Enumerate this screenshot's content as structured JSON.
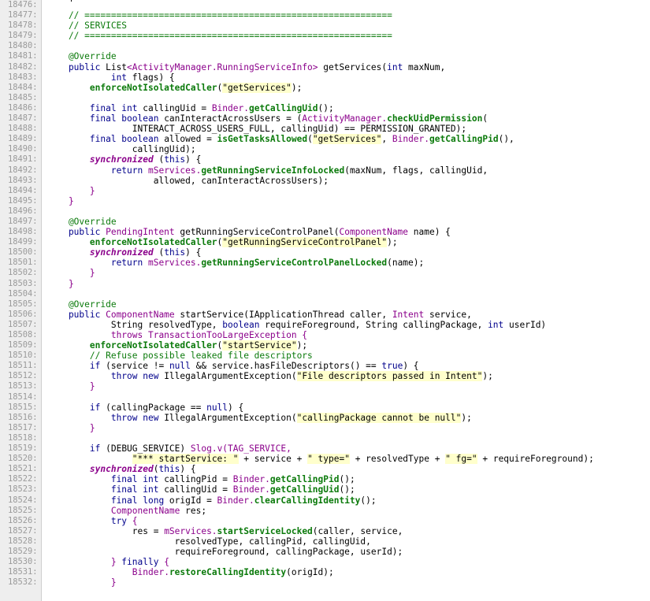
{
  "colors": {
    "comment": "#0b7a0b",
    "keyword": "#00008b",
    "type": "#8b008b",
    "method": "#0b7a0b",
    "string": "#000000",
    "string_bg": "#ffffcc",
    "annotation": "#0b7a0b",
    "line_number": "#9a9a9a",
    "gutter_bg": "#eeeeee"
  },
  "lines": [
    {
      "n": "18476:",
      "seg": [
        [
          "",
          ""
        ]
      ]
    },
    {
      "n": "18477:",
      "seg": [
        [
          "    // ==========================================================",
          "c"
        ]
      ]
    },
    {
      "n": "18478:",
      "seg": [
        [
          "    // SERVICES",
          "c"
        ]
      ]
    },
    {
      "n": "18479:",
      "seg": [
        [
          "    // ==========================================================",
          "c"
        ]
      ]
    },
    {
      "n": "18480:",
      "seg": [
        [
          "",
          ""
        ]
      ]
    },
    {
      "n": "18481:",
      "seg": [
        [
          "    @Override",
          "a"
        ]
      ]
    },
    {
      "n": "18482:",
      "seg": [
        [
          "    public ",
          "k"
        ],
        [
          "List",
          "p"
        ],
        [
          "<ActivityManager.RunningServiceInfo>",
          "t"
        ],
        [
          " getServices(",
          "p"
        ],
        [
          "int",
          "k"
        ],
        [
          " maxNum,",
          "p"
        ]
      ]
    },
    {
      "n": "18483:",
      "seg": [
        [
          "            ",
          "p"
        ],
        [
          "int",
          "k"
        ],
        [
          " flags) {",
          "p"
        ]
      ]
    },
    {
      "n": "18484:",
      "seg": [
        [
          "        ",
          "p"
        ],
        [
          "enforceNotIsolatedCaller",
          "m"
        ],
        [
          "(",
          "p"
        ],
        [
          "\"getServices\"",
          "s"
        ],
        [
          ");",
          "p"
        ]
      ]
    },
    {
      "n": "18485:",
      "seg": [
        [
          "",
          ""
        ]
      ]
    },
    {
      "n": "18486:",
      "seg": [
        [
          "        ",
          "p"
        ],
        [
          "final int",
          "k"
        ],
        [
          " callingUid = ",
          "p"
        ],
        [
          "Binder.",
          "t"
        ],
        [
          "getCallingUid",
          "m"
        ],
        [
          "();",
          "p"
        ]
      ]
    },
    {
      "n": "18487:",
      "seg": [
        [
          "        ",
          "p"
        ],
        [
          "final boolean",
          "k"
        ],
        [
          " canInteractAcrossUsers = (",
          "p"
        ],
        [
          "ActivityManager.",
          "t"
        ],
        [
          "checkUidPermission",
          "m"
        ],
        [
          "(",
          "p"
        ]
      ]
    },
    {
      "n": "18488:",
      "seg": [
        [
          "                INTERACT_ACROSS_USERS_FULL, callingUid) == PERMISSION_GRANTED);",
          "p"
        ]
      ]
    },
    {
      "n": "18489:",
      "seg": [
        [
          "        ",
          "p"
        ],
        [
          "final boolean",
          "k"
        ],
        [
          " allowed = ",
          "p"
        ],
        [
          "isGetTasksAllowed",
          "m"
        ],
        [
          "(",
          "p"
        ],
        [
          "\"getServices\"",
          "s"
        ],
        [
          ", ",
          "p"
        ],
        [
          "Binder.",
          "t"
        ],
        [
          "getCallingPid",
          "m"
        ],
        [
          "(),",
          "p"
        ]
      ]
    },
    {
      "n": "18490:",
      "seg": [
        [
          "                callingUid);",
          "p"
        ]
      ]
    },
    {
      "n": "18491:",
      "seg": [
        [
          "        ",
          "p"
        ],
        [
          "synchronized",
          "ki"
        ],
        [
          " (",
          "p"
        ],
        [
          "this",
          "k"
        ],
        [
          ") {",
          "p"
        ]
      ]
    },
    {
      "n": "18492:",
      "seg": [
        [
          "            ",
          "p"
        ],
        [
          "return",
          "k"
        ],
        [
          " mServices.",
          "t"
        ],
        [
          "getRunningServiceInfoLocked",
          "m"
        ],
        [
          "(maxNum, flags, callingUid,",
          "p"
        ]
      ]
    },
    {
      "n": "18493:",
      "seg": [
        [
          "                    allowed, canInteractAcrossUsers);",
          "p"
        ]
      ]
    },
    {
      "n": "18494:",
      "seg": [
        [
          "        }",
          "t"
        ]
      ]
    },
    {
      "n": "18495:",
      "seg": [
        [
          "    }",
          "t"
        ]
      ]
    },
    {
      "n": "18496:",
      "seg": [
        [
          "",
          ""
        ]
      ]
    },
    {
      "n": "18497:",
      "seg": [
        [
          "    @Override",
          "a"
        ]
      ]
    },
    {
      "n": "18498:",
      "seg": [
        [
          "    public ",
          "k"
        ],
        [
          "PendingIntent",
          "t"
        ],
        [
          " getRunningServiceControlPanel(",
          "p"
        ],
        [
          "ComponentName",
          "t"
        ],
        [
          " name) {",
          "p"
        ]
      ]
    },
    {
      "n": "18499:",
      "seg": [
        [
          "        ",
          "p"
        ],
        [
          "enforceNotIsolatedCaller",
          "m"
        ],
        [
          "(",
          "p"
        ],
        [
          "\"getRunningServiceControlPanel\"",
          "s"
        ],
        [
          ");",
          "p"
        ]
      ]
    },
    {
      "n": "18500:",
      "seg": [
        [
          "        ",
          "p"
        ],
        [
          "synchronized",
          "ki"
        ],
        [
          " (",
          "p"
        ],
        [
          "this",
          "k"
        ],
        [
          ") {",
          "p"
        ]
      ]
    },
    {
      "n": "18501:",
      "seg": [
        [
          "            ",
          "p"
        ],
        [
          "return",
          "k"
        ],
        [
          " mServices.",
          "t"
        ],
        [
          "getRunningServiceControlPanelLocked",
          "m"
        ],
        [
          "(name);",
          "p"
        ]
      ]
    },
    {
      "n": "18502:",
      "seg": [
        [
          "        }",
          "t"
        ]
      ]
    },
    {
      "n": "18503:",
      "seg": [
        [
          "    }",
          "t"
        ]
      ]
    },
    {
      "n": "18504:",
      "seg": [
        [
          "",
          ""
        ]
      ]
    },
    {
      "n": "18505:",
      "seg": [
        [
          "    @Override",
          "a"
        ]
      ]
    },
    {
      "n": "18506:",
      "seg": [
        [
          "    public ",
          "k"
        ],
        [
          "ComponentName",
          "t"
        ],
        [
          " startService(IApplicationThread caller, ",
          "p"
        ],
        [
          "Intent",
          "t"
        ],
        [
          " service,",
          "p"
        ]
      ]
    },
    {
      "n": "18507:",
      "seg": [
        [
          "            String resolvedType, ",
          "p"
        ],
        [
          "boolean",
          "k"
        ],
        [
          " requireForeground, String callingPackage, ",
          "p"
        ],
        [
          "int",
          "k"
        ],
        [
          " userId)",
          "p"
        ]
      ]
    },
    {
      "n": "18508:",
      "seg": [
        [
          "            ",
          "p"
        ],
        [
          "throws TransactionTooLargeException {",
          "t"
        ]
      ]
    },
    {
      "n": "18509:",
      "seg": [
        [
          "        ",
          "p"
        ],
        [
          "enforceNotIsolatedCaller",
          "m"
        ],
        [
          "(",
          "p"
        ],
        [
          "\"startService\"",
          "s"
        ],
        [
          ");",
          "p"
        ]
      ]
    },
    {
      "n": "18510:",
      "seg": [
        [
          "        // Refuse possible leaked file descriptors",
          "c"
        ]
      ]
    },
    {
      "n": "18511:",
      "seg": [
        [
          "        ",
          "p"
        ],
        [
          "if",
          "k"
        ],
        [
          " (service != ",
          "p"
        ],
        [
          "null",
          "k"
        ],
        [
          " && service.hasFileDescriptors() == ",
          "p"
        ],
        [
          "true",
          "k"
        ],
        [
          ") {",
          "p"
        ]
      ]
    },
    {
      "n": "18512:",
      "seg": [
        [
          "            ",
          "p"
        ],
        [
          "throw new",
          "k"
        ],
        [
          " IllegalArgumentException(",
          "p"
        ],
        [
          "\"File descriptors passed in Intent\"",
          "s"
        ],
        [
          ");",
          "p"
        ]
      ]
    },
    {
      "n": "18513:",
      "seg": [
        [
          "        }",
          "t"
        ]
      ]
    },
    {
      "n": "18514:",
      "seg": [
        [
          "",
          ""
        ]
      ]
    },
    {
      "n": "18515:",
      "seg": [
        [
          "        ",
          "p"
        ],
        [
          "if",
          "k"
        ],
        [
          " (callingPackage == ",
          "p"
        ],
        [
          "null",
          "k"
        ],
        [
          ") {",
          "p"
        ]
      ]
    },
    {
      "n": "18516:",
      "seg": [
        [
          "            ",
          "p"
        ],
        [
          "throw new",
          "k"
        ],
        [
          " IllegalArgumentException(",
          "p"
        ],
        [
          "\"callingPackage cannot be null\"",
          "s"
        ],
        [
          ");",
          "p"
        ]
      ]
    },
    {
      "n": "18517:",
      "seg": [
        [
          "        }",
          "t"
        ]
      ]
    },
    {
      "n": "18518:",
      "seg": [
        [
          "",
          ""
        ]
      ]
    },
    {
      "n": "18519:",
      "seg": [
        [
          "        ",
          "p"
        ],
        [
          "if",
          "k"
        ],
        [
          " (DEBUG_SERVICE) ",
          "p"
        ],
        [
          "Slog.v(TAG_SERVICE,",
          "t"
        ]
      ]
    },
    {
      "n": "18520:",
      "seg": [
        [
          "                ",
          "p"
        ],
        [
          "\"*** startService: \"",
          "s"
        ],
        [
          " + service + ",
          "p"
        ],
        [
          "\" type=\"",
          "s"
        ],
        [
          " + resolvedType + ",
          "p"
        ],
        [
          "\" fg=\"",
          "s"
        ],
        [
          " + requireForeground);",
          "p"
        ]
      ]
    },
    {
      "n": "18521:",
      "seg": [
        [
          "        ",
          "p"
        ],
        [
          "synchronized",
          "ki"
        ],
        [
          "(",
          "p"
        ],
        [
          "this",
          "k"
        ],
        [
          ") {",
          "p"
        ]
      ]
    },
    {
      "n": "18522:",
      "seg": [
        [
          "            ",
          "p"
        ],
        [
          "final int",
          "k"
        ],
        [
          " callingPid = ",
          "p"
        ],
        [
          "Binder.",
          "t"
        ],
        [
          "getCallingPid",
          "m"
        ],
        [
          "();",
          "p"
        ]
      ]
    },
    {
      "n": "18523:",
      "seg": [
        [
          "            ",
          "p"
        ],
        [
          "final int",
          "k"
        ],
        [
          " callingUid = ",
          "p"
        ],
        [
          "Binder.",
          "t"
        ],
        [
          "getCallingUid",
          "m"
        ],
        [
          "();",
          "p"
        ]
      ]
    },
    {
      "n": "18524:",
      "seg": [
        [
          "            ",
          "p"
        ],
        [
          "final long",
          "k"
        ],
        [
          " origId = ",
          "p"
        ],
        [
          "Binder.",
          "t"
        ],
        [
          "clearCallingIdentity",
          "m"
        ],
        [
          "();",
          "p"
        ]
      ]
    },
    {
      "n": "18525:",
      "seg": [
        [
          "            ",
          "p"
        ],
        [
          "ComponentName",
          "t"
        ],
        [
          " res;",
          "p"
        ]
      ]
    },
    {
      "n": "18526:",
      "seg": [
        [
          "            ",
          "p"
        ],
        [
          "try",
          "k"
        ],
        [
          " {",
          "t"
        ]
      ]
    },
    {
      "n": "18527:",
      "seg": [
        [
          "                res = ",
          "p"
        ],
        [
          "mServices.",
          "t"
        ],
        [
          "startServiceLocked",
          "m"
        ],
        [
          "(caller, service,",
          "p"
        ]
      ]
    },
    {
      "n": "18528:",
      "seg": [
        [
          "                        resolvedType, callingPid, callingUid,",
          "p"
        ]
      ]
    },
    {
      "n": "18529:",
      "seg": [
        [
          "                        requireForeground, callingPackage, userId);",
          "p"
        ]
      ]
    },
    {
      "n": "18530:",
      "seg": [
        [
          "            } ",
          "t"
        ],
        [
          "finally",
          "k"
        ],
        [
          " {",
          "t"
        ]
      ]
    },
    {
      "n": "18531:",
      "seg": [
        [
          "                ",
          "p"
        ],
        [
          "Binder.",
          "t"
        ],
        [
          "restoreCallingIdentity",
          "m"
        ],
        [
          "(origId);",
          "p"
        ]
      ]
    },
    {
      "n": "18532:",
      "seg": [
        [
          "            }",
          "t"
        ]
      ]
    }
  ]
}
